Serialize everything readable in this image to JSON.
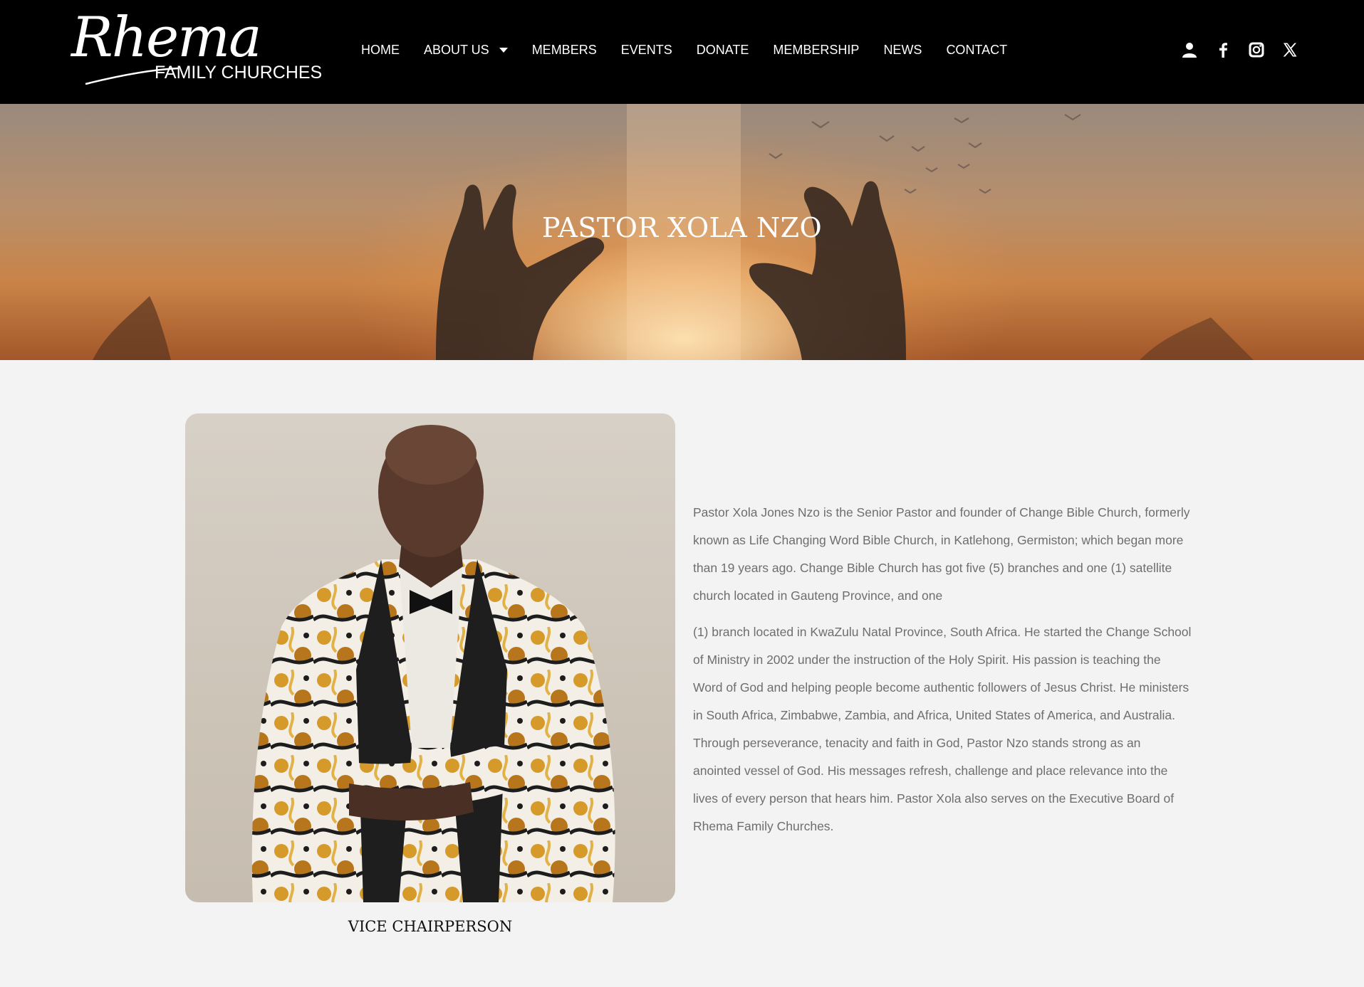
{
  "brand": {
    "script": "Rhema",
    "subtitle": "FAMILY CHURCHES"
  },
  "nav": {
    "items": [
      {
        "label": "HOME"
      },
      {
        "label": "ABOUT US",
        "has_dropdown": true
      },
      {
        "label": "MEMBERS"
      },
      {
        "label": "EVENTS"
      },
      {
        "label": "DONATE"
      },
      {
        "label": "MEMBERSHIP"
      },
      {
        "label": "NEWS"
      },
      {
        "label": "CONTACT"
      }
    ]
  },
  "social": {
    "icons": [
      "user-icon",
      "facebook-icon",
      "instagram-icon",
      "x-twitter-icon"
    ]
  },
  "hero": {
    "title": "PASTOR XOLA NZO"
  },
  "profile": {
    "caption": "VICE CHAIRPERSON",
    "bio_paragraphs": [
      "Pastor Xola Jones Nzo is the Senior Pastor and founder of Change Bible Church, formerly known as Life Changing Word Bible Church, in Katlehong, Germiston; which began more than 19 years ago. Change Bible Church has got five (5) branches and one (1) satellite church located in Gauteng Province, and one",
      "(1) branch located in KwaZulu Natal Province, South Africa. He started the Change School of Ministry in 2002 under the instruction of the Holy Spirit. His passion is teaching the Word of God and helping people become authentic followers of Jesus Christ. He ministers in South Africa, Zimbabwe, Zambia, and Africa, United States of America, and Australia. Through perseverance, tenacity and faith in God, Pastor Nzo stands strong as an anointed vessel of God. His messages refresh, challenge and place relevance into the lives of every person that hears him. Pastor Xola also serves on the Executive Board of Rhema Family Churches."
    ]
  },
  "colors": {
    "header_bg": "#000000",
    "page_bg": "#f3f3f3",
    "body_text": "#6e6e6e"
  }
}
